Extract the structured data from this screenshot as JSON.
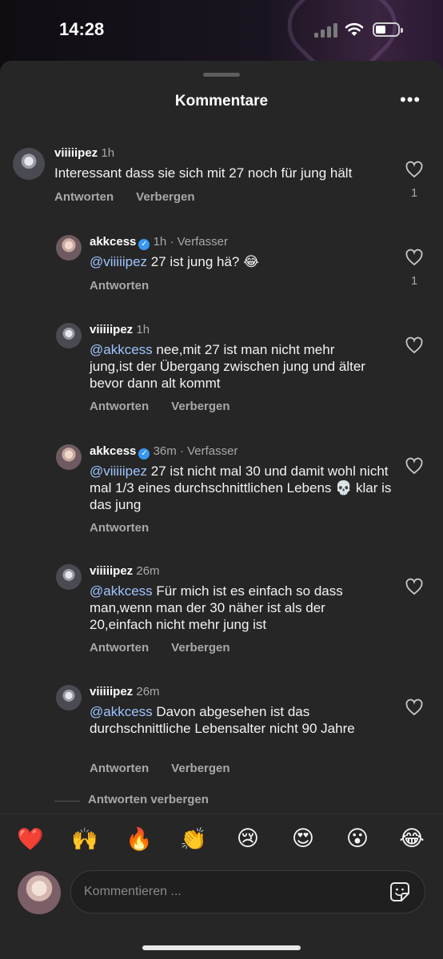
{
  "status_bar": {
    "time": "14:28"
  },
  "sheet": {
    "title": "Kommentare",
    "more_label": "•••"
  },
  "comments": [
    {
      "user": "viiiiipez",
      "time": "1h",
      "tag": "",
      "verified": false,
      "mention": "",
      "text": "Interessant dass sie sich mit 27 noch für jung hält",
      "likes": "1",
      "actions": [
        "Antworten",
        "Verbergen"
      ]
    },
    {
      "user": "akkcess",
      "time": "1h",
      "tag": "· Verfasser",
      "verified": true,
      "mention": "@viiiiipez",
      "text": " 27 ist jung hä? 😂",
      "likes": "1",
      "actions": [
        "Antworten"
      ]
    },
    {
      "user": "viiiiipez",
      "time": "1h",
      "tag": "",
      "verified": false,
      "mention": "@akkcess",
      "text": " nee,mit 27 ist man nicht mehr jung,ist der Übergang zwischen jung und älter bevor dann alt kommt",
      "likes": "",
      "actions": [
        "Antworten",
        "Verbergen"
      ]
    },
    {
      "user": "akkcess",
      "time": "36m",
      "tag": "· Verfasser",
      "verified": true,
      "mention": "@viiiiipez",
      "text": " 27 ist nicht mal 30 und damit wohl nicht mal 1/3 eines durchschnittlichen Lebens 💀 klar is das jung",
      "likes": "",
      "actions": [
        "Antworten"
      ]
    },
    {
      "user": "viiiiipez",
      "time": "26m",
      "tag": "",
      "verified": false,
      "mention": "@akkcess",
      "text": " Für mich ist es einfach so dass man,wenn man der 30 näher ist als der 20,einfach nicht mehr jung ist",
      "likes": "",
      "actions": [
        "Antworten",
        "Verbergen"
      ]
    },
    {
      "user": "viiiiipez",
      "time": "26m",
      "tag": "",
      "verified": false,
      "mention": "@akkcess",
      "text": " Davon abgesehen ist das durchschnittliche Lebensalter nicht 90 Jahre",
      "likes": "",
      "actions": [
        "Antworten",
        "Verbergen"
      ]
    }
  ],
  "hide_replies": "Antworten verbergen",
  "emoji_bar": [
    "❤️",
    "🙌",
    "🔥",
    "👏",
    "😢",
    "😍",
    "😮",
    "😂"
  ],
  "composer": {
    "placeholder": "Kommentieren ..."
  },
  "icons": {
    "like": "heart-outline-icon",
    "sticker": "sticker-icon",
    "verified": "verified-badge-icon"
  },
  "colors": {
    "sheet_bg": "#262626",
    "mention": "#9fc4ff",
    "verified": "#3897f0"
  }
}
